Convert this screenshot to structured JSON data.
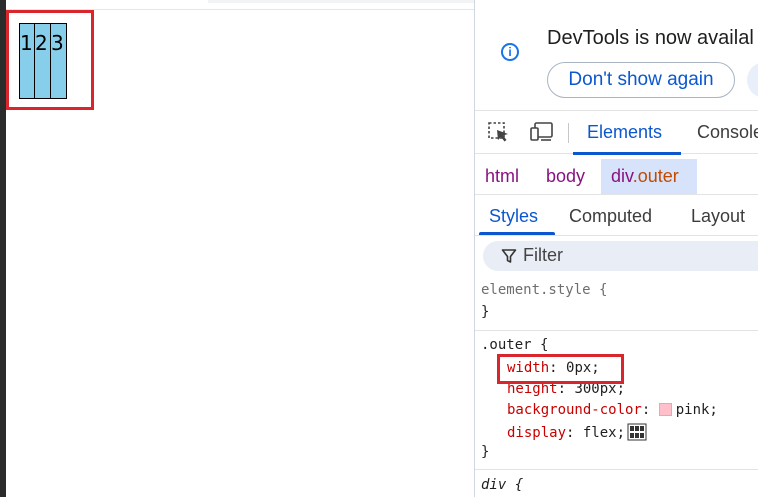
{
  "page": {
    "demo_items": [
      "1",
      "2",
      "3"
    ]
  },
  "devtools": {
    "notice": {
      "text": "DevTools is now availal",
      "dont_show_button": "Don't show again"
    },
    "toolbar": {
      "tabs": [
        "Elements",
        "Console"
      ]
    },
    "breadcrumbs": {
      "html": "html",
      "body": "body",
      "selected_tag": "div",
      "selected_class": ".outer"
    },
    "subtabs": [
      "Styles",
      "Computed",
      "Layout"
    ],
    "filter_placeholder": "Filter",
    "styles": {
      "element_style": {
        "selector": "element.style {",
        "close": "}"
      },
      "outer_rule": {
        "selector": ".outer {",
        "properties": [
          {
            "name": "width",
            "value": "0px;"
          },
          {
            "name": "height",
            "value": "300px;"
          },
          {
            "name": "background-color",
            "value": "pink;"
          },
          {
            "name": "display",
            "value": "flex;"
          }
        ],
        "close": "}"
      },
      "div_rule": {
        "selector": "div {"
      }
    },
    "colors": {
      "accent": "#0b57d0",
      "demo_item_bg": "#87ceeb",
      "swatch_pink": "#ffc0cb",
      "highlight_red": "#d9262c"
    }
  }
}
